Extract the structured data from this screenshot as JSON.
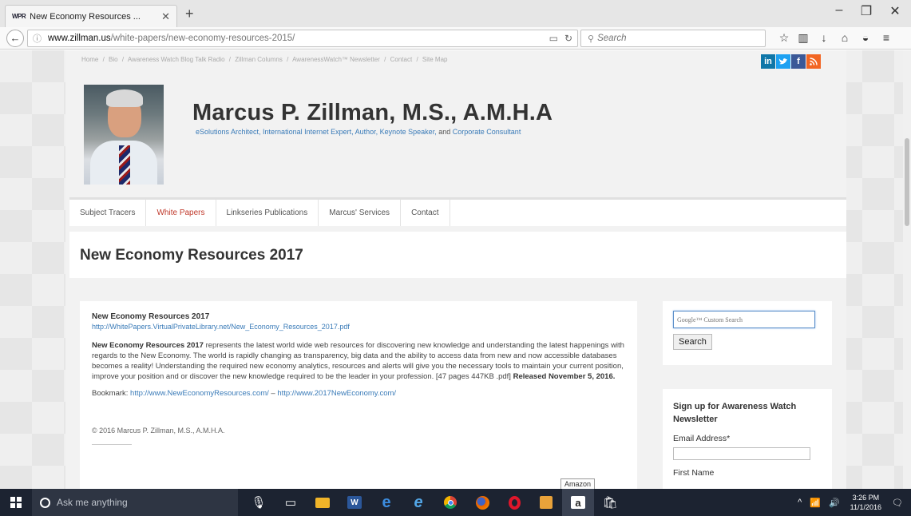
{
  "browser": {
    "tab_title": "New Economy Resources ...",
    "tab_favicon": "WPR",
    "url_domain": "www.zillman.us",
    "url_path": "/white-papers/new-economy-resources-2015/",
    "search_placeholder": "Search"
  },
  "site": {
    "top_nav": [
      "Home",
      "/",
      "Bio",
      "/",
      "Awareness Watch Blog Talk Radio",
      "/",
      "Zillman Columns",
      "/",
      "AwarenessWatch™ Newsletter",
      "/",
      "Contact",
      "/",
      "Site Map"
    ],
    "social": [
      {
        "label": "in",
        "color": "#0e76a8"
      },
      {
        "label": "t",
        "color": "#1da1f2"
      },
      {
        "label": "f",
        "color": "#3b5998"
      },
      {
        "label": "rss",
        "color": "#f26522"
      }
    ],
    "name": "Marcus P. Zillman, M.S., A.M.H.A",
    "tagline_link": "eSolutions Architect, International Internet Expert, Author, Keynote Speaker,",
    "tagline_and": "and",
    "tagline_link2": "Corporate Consultant",
    "menu": [
      "Subject Tracers",
      "White Papers",
      "Linkseries Publications",
      "Marcus' Services",
      "Contact"
    ]
  },
  "main": {
    "page_title": "New Economy Resources 2017",
    "heading": "New Economy Resources 2017",
    "pdf_link": "http://WhitePapers.VirtualPrivateLibrary.net/New_Economy_Resources_2017.pdf",
    "body_bold": "New Economy Resources 2017",
    "body_text": " represents the latest world wide web resources for discovering new knowledge and understanding the latest happenings with regards to the New Economy. The world is rapidly changing as transparency, big data and the ability to access data from new and now accessible databases becomes a reality! Understanding the required new economy analytics, resources and alerts will give you the necessary tools to maintain your current position, improve your position and or discover the new knowledge required to be the leader in your profession. [47 pages  447KB .pdf] ",
    "released": "Released November 5, 2016.",
    "bookmark_label": "Bookmark:",
    "bookmark_link1": "http://www.NewEconomyResources.com/",
    "bookmark_sep": " – ",
    "bookmark_link2": "http://www.2017NewEconomy.com/",
    "copyright": "© 2016 Marcus P. Zillman, M.S., A.M.H.A.",
    "tooltip": "Amazon"
  },
  "sidebar": {
    "search_placeholder": "Google™ Custom Search",
    "search_button": "Search",
    "newsletter_title": "Sign up for Awareness Watch Newsletter",
    "email_label": "Email Address*",
    "first_name_label": "First Name"
  },
  "taskbar": {
    "search_text": "Ask me anything",
    "time": "3:26 PM",
    "date": "11/1/2016"
  }
}
